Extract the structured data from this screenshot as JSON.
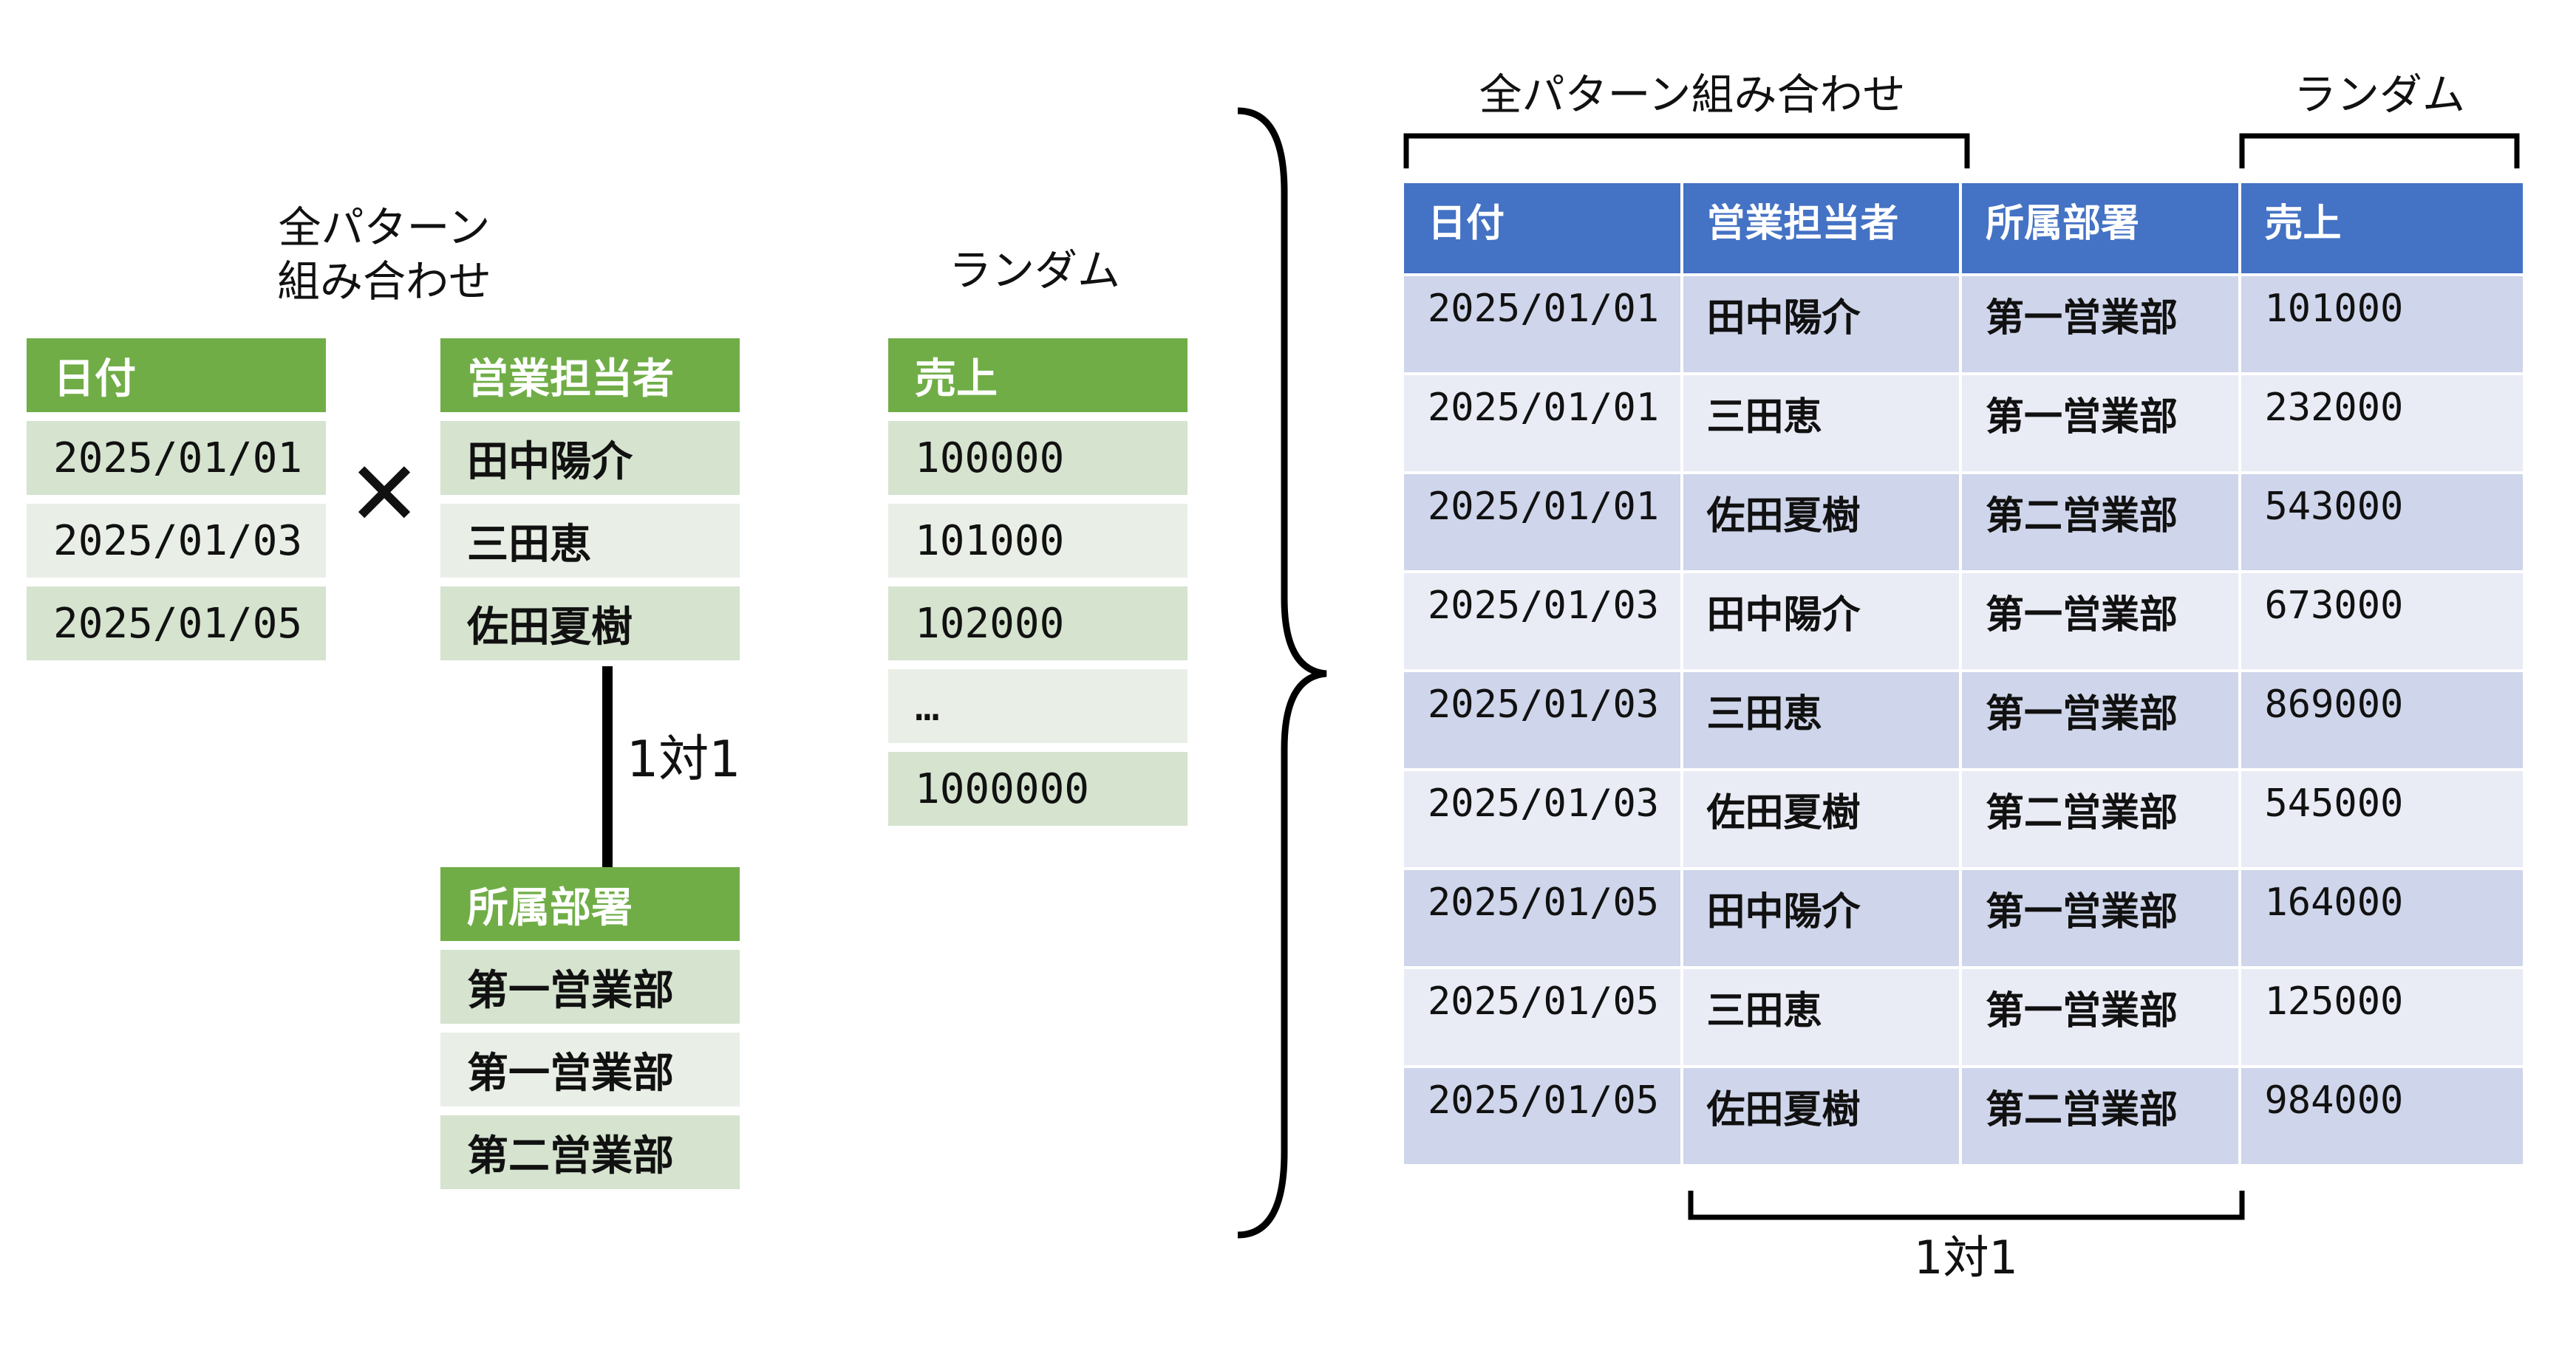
{
  "left": {
    "label_all_patterns_line1": "全パターン",
    "label_all_patterns_line2": "組み合わせ",
    "label_random": "ランダム",
    "cross_symbol": "✕",
    "one_to_one": "1対1",
    "date_table": {
      "header": "日付",
      "rows": [
        "2025/01/01",
        "2025/01/03",
        "2025/01/05"
      ]
    },
    "staff_table": {
      "header": "営業担当者",
      "rows": [
        "田中陽介",
        "三田恵",
        "佐田夏樹"
      ]
    },
    "dept_table": {
      "header": "所属部署",
      "rows": [
        "第一営業部",
        "第一営業部",
        "第二営業部"
      ]
    },
    "sales_table": {
      "header": "売上",
      "rows": [
        "100000",
        "101000",
        "102000",
        "…",
        "1000000"
      ]
    }
  },
  "right": {
    "label_all_patterns": "全パターン組み合わせ",
    "label_random": "ランダム",
    "one_to_one": "1対1",
    "headers": [
      "日付",
      "営業担当者",
      "所属部署",
      "売上"
    ],
    "rows": [
      [
        "2025/01/01",
        "田中陽介",
        "第一営業部",
        "101000"
      ],
      [
        "2025/01/01",
        "三田恵",
        "第一営業部",
        "232000"
      ],
      [
        "2025/01/01",
        "佐田夏樹",
        "第二営業部",
        "543000"
      ],
      [
        "2025/01/03",
        "田中陽介",
        "第一営業部",
        "673000"
      ],
      [
        "2025/01/03",
        "三田恵",
        "第一営業部",
        "869000"
      ],
      [
        "2025/01/03",
        "佐田夏樹",
        "第二営業部",
        "545000"
      ],
      [
        "2025/01/05",
        "田中陽介",
        "第一営業部",
        "164000"
      ],
      [
        "2025/01/05",
        "三田恵",
        "第一営業部",
        "125000"
      ],
      [
        "2025/01/05",
        "佐田夏樹",
        "第二営業部",
        "984000"
      ]
    ]
  },
  "colors": {
    "green_header": "#70ad47",
    "green_odd": "#d5e3cf",
    "green_even": "#e9efe6",
    "blue_header": "#4472c4",
    "blue_odd": "#cfd5ea",
    "blue_even": "#e9ebf5"
  }
}
